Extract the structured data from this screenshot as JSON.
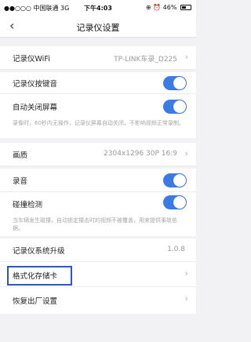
{
  "status_bar": {
    "carrier": "●●○○○ 中国联通  3G",
    "time": "下午4:03",
    "battery_label": "⊕ ⏰ 46%"
  },
  "nav": {
    "back_icon": "chevron-left",
    "title": "记录仪设置"
  },
  "settings": {
    "wifi": {
      "label": "记录仪WiFi",
      "value": "TP-LINK车录_D225"
    },
    "key_sound": {
      "label": "记录仪按键音",
      "enabled": true
    },
    "auto_screen_off": {
      "label": "自动关闭屏幕",
      "enabled": true,
      "description": "录像时，60秒内无操作，记录仪屏幕自动关闭，不影响视频正常录制。"
    },
    "quality": {
      "label": "画质",
      "value": "2304x1296 30P 16:9"
    },
    "audio": {
      "label": "录音",
      "enabled": true
    },
    "collision": {
      "label": "碰撞检测",
      "enabled": true,
      "description": "当车辆发生碰撞，自动锁定撞击时的视频不被覆盖，用来提供事故依据。"
    },
    "firmware": {
      "label": "记录仪系统升级",
      "value": "1.0.8"
    },
    "format_card": {
      "label": "格式化存储卡"
    },
    "factory_reset": {
      "label": "恢复出厂设置"
    }
  },
  "colors": {
    "toggle_on": "#3b7be6",
    "highlight": "#2b57c8"
  }
}
